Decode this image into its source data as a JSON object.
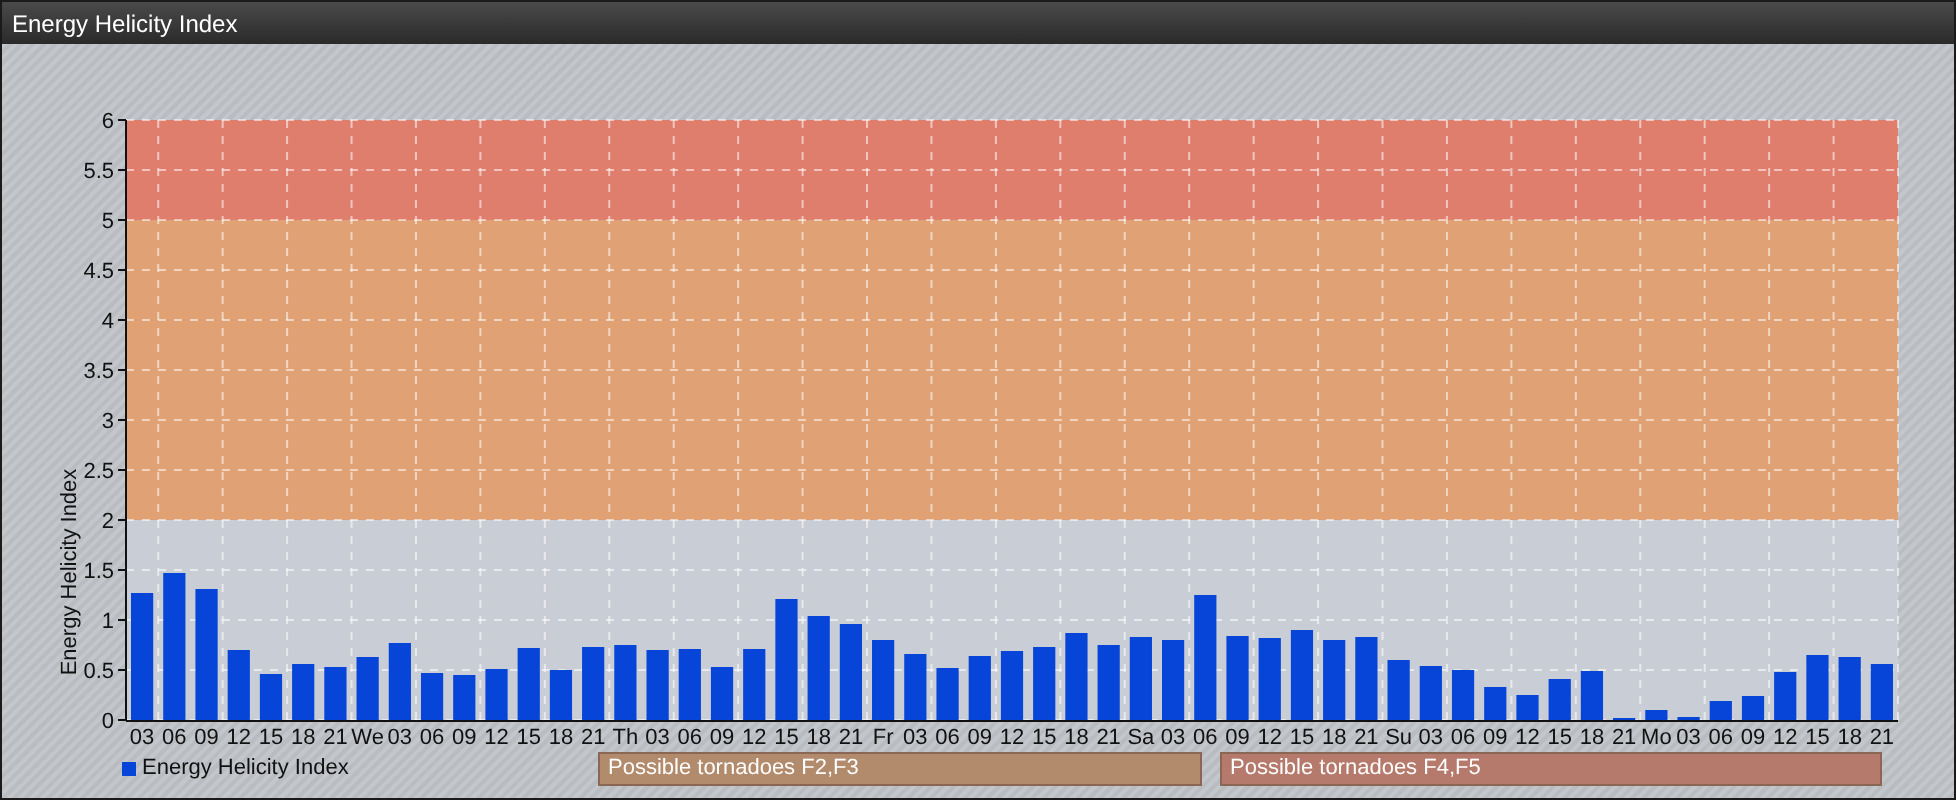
{
  "window": {
    "title": "Energy Helicity Index"
  },
  "chart": {
    "chart_data": {
      "type": "bar",
      "ylabel": "Energy Helicity Index",
      "categories": [
        "03",
        "06",
        "09",
        "12",
        "15",
        "18",
        "21",
        "We",
        "03",
        "06",
        "09",
        "12",
        "15",
        "18",
        "21",
        "Th",
        "03",
        "06",
        "09",
        "12",
        "15",
        "18",
        "21",
        "Fr",
        "03",
        "06",
        "09",
        "12",
        "15",
        "18",
        "21",
        "Sa",
        "03",
        "06",
        "09",
        "12",
        "15",
        "18",
        "21",
        "Su",
        "03",
        "06",
        "09",
        "12",
        "15",
        "18",
        "21",
        "Mo",
        "03",
        "06",
        "09",
        "12",
        "15",
        "18",
        "21"
      ],
      "series": [
        {
          "name": "Energy Helicity Index",
          "color": "#0645d8",
          "values": [
            1.27,
            1.47,
            1.31,
            0.7,
            0.46,
            0.56,
            0.53,
            0.63,
            0.77,
            0.47,
            0.45,
            0.51,
            0.72,
            0.5,
            0.73,
            0.75,
            0.7,
            0.71,
            0.53,
            0.71,
            1.21,
            1.04,
            0.96,
            0.8,
            0.66,
            0.52,
            0.64,
            0.69,
            0.73,
            0.87,
            0.75,
            0.83,
            0.8,
            1.25,
            0.84,
            0.82,
            0.9,
            0.8,
            0.83,
            0.6,
            0.54,
            0.5,
            0.33,
            0.25,
            0.41,
            0.49,
            0.02,
            0.1,
            0.03,
            0.19,
            0.24,
            0.48,
            0.65,
            0.63,
            0.56
          ]
        }
      ],
      "ylim": [
        0,
        6
      ],
      "yticks": [
        0,
        0.5,
        1,
        1.5,
        2,
        2.5,
        3,
        3.5,
        4,
        4.5,
        5,
        5.5,
        6
      ],
      "grid": true,
      "bands": [
        {
          "axis": "y",
          "from": 0,
          "to": 2,
          "color": "#c9ced6"
        },
        {
          "axis": "y",
          "from": 2,
          "to": 5,
          "color": "#e0a274"
        },
        {
          "axis": "y",
          "from": 5,
          "to": 6,
          "color": "#e07e6e"
        }
      ]
    },
    "notes": [
      {
        "label": "Possible tornadoes F2,F3",
        "color": "#b28a6c"
      },
      {
        "label": "Possible tornadoes F4,F5",
        "color": "#b67a6c"
      }
    ]
  }
}
